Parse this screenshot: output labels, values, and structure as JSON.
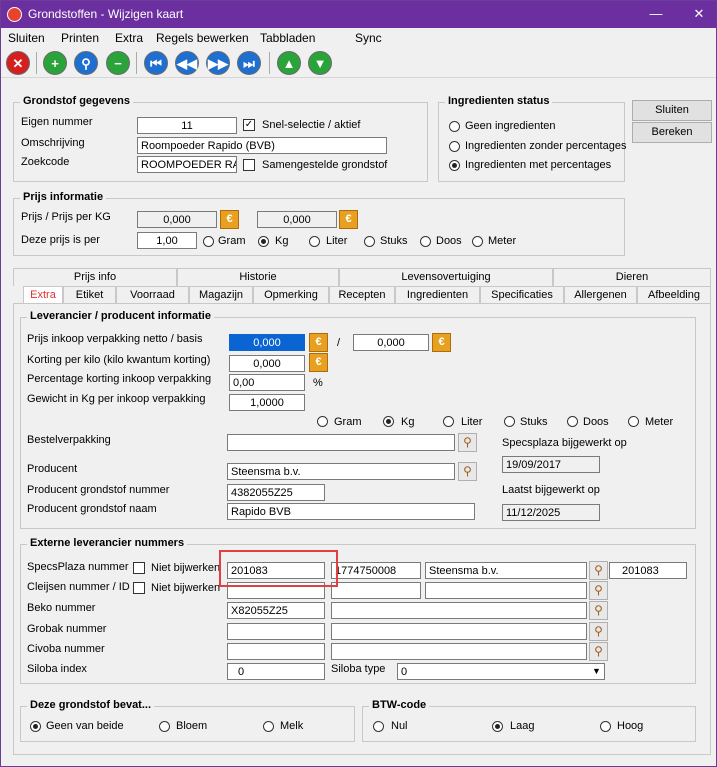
{
  "window": {
    "title": "Grondstoffen - Wijzigen kaart",
    "minimize": "—",
    "close": "✕"
  },
  "menu": [
    "Sluiten",
    "Printen",
    "Extra",
    "Regels bewerken",
    "Tabbladen",
    "Sync"
  ],
  "toolbar": {
    "icons": [
      "close-icon",
      "add-icon",
      "search-icon",
      "remove-icon",
      "first-icon",
      "prev-icon",
      "next-icon",
      "last-icon",
      "up-icon",
      "down-icon"
    ]
  },
  "grondstof": {
    "title": "Grondstof gegevens",
    "eigen_nummer_label": "Eigen nummer",
    "eigen_nummer": "11",
    "snel_selectie_label": "Snel-selectie  / aktief",
    "omschrijving_label": "Omschrijving",
    "omschrijving": "Roompoeder Rapido (BVB)",
    "zoekcode_label": "Zoekcode",
    "zoekcode": "ROOMPOEDER RA",
    "samengestelde_label": "Samengestelde grondstof"
  },
  "ingredienten_status": {
    "title": "Ingredienten status",
    "options": [
      "Geen ingredienten",
      "Ingredienten zonder percentages",
      "Ingredienten met percentages"
    ],
    "selected": 2
  },
  "buttons": {
    "sluiten": "Sluiten",
    "bereken": "Bereken"
  },
  "prijs": {
    "title": "Prijs informatie",
    "prijs_label": "Prijs / Prijs per KG",
    "prijs1": "0,000",
    "prijs2": "0,000",
    "deze_prijs_label": "Deze prijs is per",
    "deze_prijs": "1,00",
    "units": [
      "Gram",
      "Kg",
      "Liter",
      "Stuks",
      "Doos",
      "Meter"
    ],
    "selected_unit": 1
  },
  "tabs_top": [
    "Prijs info",
    "Historie",
    "Levensovertuiging",
    "Dieren"
  ],
  "tabs_bottom": [
    "Extra",
    "Etiket",
    "Voorraad",
    "Magazijn",
    "Opmerking",
    "Recepten",
    "Ingredienten",
    "Specificaties",
    "Allergenen",
    "Afbeelding"
  ],
  "leverancier": {
    "title": "Leverancier / producent informatie",
    "prijs_inkoop_label": "Prijs inkoop verpakking  netto / basis",
    "prijs_inkoop": "0,000",
    "prijs_basis": "0,000",
    "slash": "/",
    "korting_label": "Korting per kilo (kilo kwantum korting)",
    "korting": "0,000",
    "perc_label": "Percentage korting inkoop verpakking",
    "perc": "0,00",
    "perc_unit": "%",
    "gewicht_label": "Gewicht in Kg per inkoop verpakking",
    "gewicht": "1,0000",
    "units": [
      "Gram",
      "Kg",
      "Liter",
      "Stuks",
      "Doos",
      "Meter"
    ],
    "selected_unit": 1,
    "bestel_label": "Bestelverpakking",
    "bestel": "",
    "specsplaza_label": "Specsplaza bijgewerkt op",
    "specsplaza_date": "19/09/2017",
    "producent_label": "Producent",
    "producent": "Steensma b.v.",
    "prod_nummer_label": "Producent grondstof nummer",
    "prod_nummer": "4382055Z25",
    "prod_naam_label": "Producent grondstof naam",
    "prod_naam": "Rapido BVB",
    "laatst_label": "Laatst bijgewerkt op",
    "laatst_date": "11/12/2025"
  },
  "extern": {
    "title": "Externe leverancier nummers",
    "niet_bijwerken": "Niet bijwerken",
    "specsplaza_label": "SpecsPlaza nummer",
    "specsplaza_nr": "201083",
    "specsplaza_code": "1774750008",
    "specsplaza_naam": "Steensma b.v.",
    "specsplaza_id": "201083",
    "cleijsen_label": "Cleijsen nummer / ID",
    "beko_label": "Beko nummer",
    "beko_nr": "X82055Z25",
    "grobak_label": "Grobak nummer",
    "civoba_label": "Civoba nummer",
    "siloba_label": "Siloba index",
    "siloba_index": "0",
    "siloba_type_label": "Siloba type",
    "siloba_type": "0"
  },
  "bevat": {
    "title": "Deze grondstof bevat...",
    "options": [
      "Geen van beide",
      "Bloem",
      "Melk"
    ],
    "selected": 0
  },
  "btw": {
    "title": "BTW-code",
    "options": [
      "Nul",
      "Laag",
      "Hoog"
    ],
    "selected": 1
  },
  "colors": {
    "titlebar": "#6b2fa0",
    "active_tab": "#e03030",
    "highlight": "#e04040"
  }
}
